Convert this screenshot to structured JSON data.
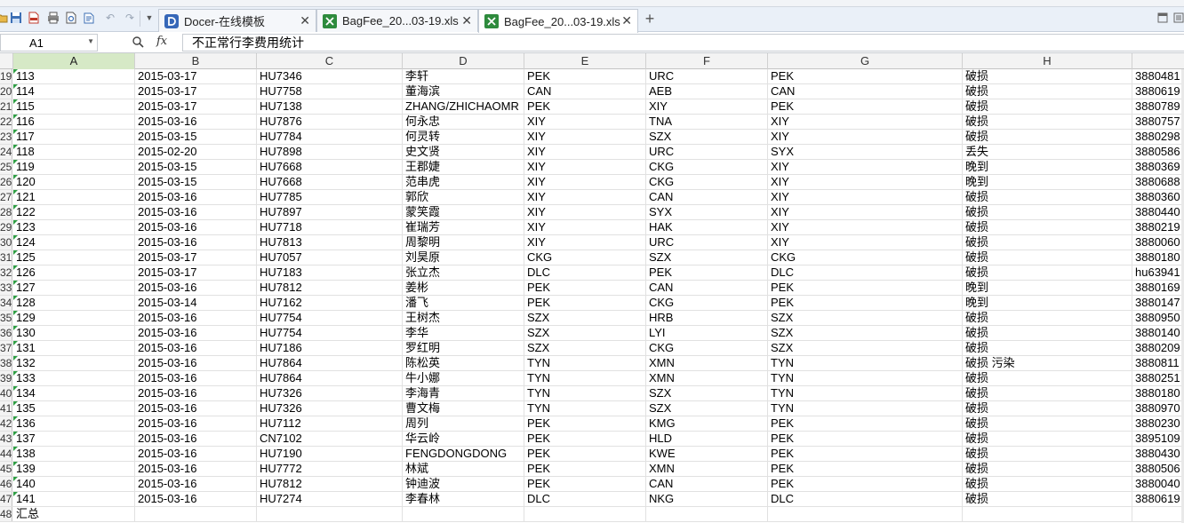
{
  "toolbar": {
    "tabs": [
      {
        "label": "Docer-在线模板",
        "icon": "docer-icon"
      },
      {
        "label": "BagFee_20...03-19.xls",
        "icon": "excel-icon"
      },
      {
        "label": "BagFee_20...03-19.xls",
        "icon": "excel-icon",
        "active": true
      }
    ],
    "new_tab": "+"
  },
  "formula_bar": {
    "name_box": "A1",
    "fx": "fx",
    "value": "不正常行李费用统计"
  },
  "columns": [
    "A",
    "B",
    "C",
    "D",
    "E",
    "F",
    "G",
    "H"
  ],
  "selected_column": "A",
  "rows": [
    {
      "n": "19",
      "cells": [
        "113",
        "2015-03-17",
        "HU7346",
        "李轩",
        "PEK",
        "URC",
        "PEK",
        "破损",
        "3880481"
      ]
    },
    {
      "n": "20",
      "cells": [
        "114",
        "2015-03-17",
        "HU7758",
        "董海滨",
        "CAN",
        "AEB",
        "CAN",
        "破损",
        "3880619"
      ]
    },
    {
      "n": "21",
      "cells": [
        "115",
        "2015-03-17",
        "HU7138",
        "ZHANG/ZHICHAOMR",
        "PEK",
        "XIY",
        "PEK",
        "破损",
        "3880789"
      ]
    },
    {
      "n": "22",
      "cells": [
        "116",
        "2015-03-16",
        "HU7876",
        "何永忠",
        "XIY",
        "TNA",
        "XIY",
        "破损",
        "3880757"
      ]
    },
    {
      "n": "23",
      "cells": [
        "117",
        "2015-03-15",
        "HU7784",
        "何灵转",
        "XIY",
        "SZX",
        "XIY",
        "破损",
        "3880298"
      ]
    },
    {
      "n": "24",
      "cells": [
        "118",
        "2015-02-20",
        "HU7898",
        "史文贤",
        "XIY",
        "URC",
        "SYX",
        "丢失",
        "3880586"
      ]
    },
    {
      "n": "25",
      "cells": [
        "119",
        "2015-03-15",
        "HU7668",
        "王郡婕",
        "XIY",
        "CKG",
        "XIY",
        "晚到",
        "3880369"
      ]
    },
    {
      "n": "26",
      "cells": [
        "120",
        "2015-03-15",
        "HU7668",
        "范串虎",
        "XIY",
        "CKG",
        "XIY",
        "晚到",
        "3880688"
      ]
    },
    {
      "n": "27",
      "cells": [
        "121",
        "2015-03-16",
        "HU7785",
        "郭欣",
        "XIY",
        "CAN",
        "XIY",
        "破损",
        "3880360"
      ]
    },
    {
      "n": "28",
      "cells": [
        "122",
        "2015-03-16",
        "HU7897",
        "蒙笑霞",
        "XIY",
        "SYX",
        "XIY",
        "破损",
        "3880440"
      ]
    },
    {
      "n": "29",
      "cells": [
        "123",
        "2015-03-16",
        "HU7718",
        "崔瑞芳",
        "XIY",
        "HAK",
        "XIY",
        "破损",
        "3880219"
      ]
    },
    {
      "n": "30",
      "cells": [
        "124",
        "2015-03-16",
        "HU7813",
        "周黎明",
        "XIY",
        "URC",
        "XIY",
        "破损",
        "3880060"
      ]
    },
    {
      "n": "31",
      "cells": [
        "125",
        "2015-03-17",
        "HU7057",
        "刘昊原",
        "CKG",
        "SZX",
        "CKG",
        "破损",
        "3880180"
      ]
    },
    {
      "n": "32",
      "cells": [
        "126",
        "2015-03-17",
        "HU7183",
        "张立杰",
        "DLC",
        "PEK",
        "DLC",
        "破损",
        "hu63941"
      ]
    },
    {
      "n": "33",
      "cells": [
        "127",
        "2015-03-16",
        "HU7812",
        "姜彬",
        "PEK",
        "CAN",
        "PEK",
        "晚到",
        "3880169"
      ]
    },
    {
      "n": "34",
      "cells": [
        "128",
        "2015-03-14",
        "HU7162",
        "潘飞",
        "PEK",
        "CKG",
        "PEK",
        "晚到",
        "3880147"
      ]
    },
    {
      "n": "35",
      "cells": [
        "129",
        "2015-03-16",
        "HU7754",
        "王树杰",
        "SZX",
        "HRB",
        "SZX",
        "破损",
        "3880950"
      ]
    },
    {
      "n": "36",
      "cells": [
        "130",
        "2015-03-16",
        "HU7754",
        "李华",
        "SZX",
        "LYI",
        "SZX",
        "破损",
        "3880140"
      ]
    },
    {
      "n": "37",
      "cells": [
        "131",
        "2015-03-16",
        "HU7186",
        "罗红明",
        "SZX",
        "CKG",
        "SZX",
        "破损",
        "3880209"
      ]
    },
    {
      "n": "38",
      "cells": [
        "132",
        "2015-03-16",
        "HU7864",
        "陈松英",
        "TYN",
        "XMN",
        "TYN",
        "破损 污染",
        "3880811"
      ]
    },
    {
      "n": "39",
      "cells": [
        "133",
        "2015-03-16",
        "HU7864",
        "牛小娜",
        "TYN",
        "XMN",
        "TYN",
        "破损",
        "3880251"
      ]
    },
    {
      "n": "40",
      "cells": [
        "134",
        "2015-03-16",
        "HU7326",
        "李海青",
        "TYN",
        "SZX",
        "TYN",
        "破损",
        "3880180"
      ]
    },
    {
      "n": "41",
      "cells": [
        "135",
        "2015-03-16",
        "HU7326",
        "曹文梅",
        "TYN",
        "SZX",
        "TYN",
        "破损",
        "3880970"
      ]
    },
    {
      "n": "42",
      "cells": [
        "136",
        "2015-03-16",
        "HU7112",
        "周列",
        "PEK",
        "KMG",
        "PEK",
        "破损",
        "3880230"
      ]
    },
    {
      "n": "43",
      "cells": [
        "137",
        "2015-03-16",
        "CN7102",
        "华云岭",
        "PEK",
        "HLD",
        "PEK",
        "破损",
        "3895109"
      ]
    },
    {
      "n": "44",
      "cells": [
        "138",
        "2015-03-16",
        "HU7190",
        "FENGDONGDONG",
        "PEK",
        "KWE",
        "PEK",
        "破损",
        "3880430"
      ]
    },
    {
      "n": "45",
      "cells": [
        "139",
        "2015-03-16",
        "HU7772",
        "林斌",
        "PEK",
        "XMN",
        "PEK",
        "破损",
        "3880506"
      ]
    },
    {
      "n": "46",
      "cells": [
        "140",
        "2015-03-16",
        "HU7812",
        "钟迪波",
        "PEK",
        "CAN",
        "PEK",
        "破损",
        "3880040"
      ]
    },
    {
      "n": "47",
      "cells": [
        "141",
        "2015-03-16",
        "HU7274",
        "李春林",
        "DLC",
        "NKG",
        "DLC",
        "破损",
        "3880619"
      ]
    },
    {
      "n": "48",
      "cells": [
        "汇总",
        "",
        "",
        "",
        "",
        "",
        "",
        "",
        ""
      ]
    }
  ]
}
